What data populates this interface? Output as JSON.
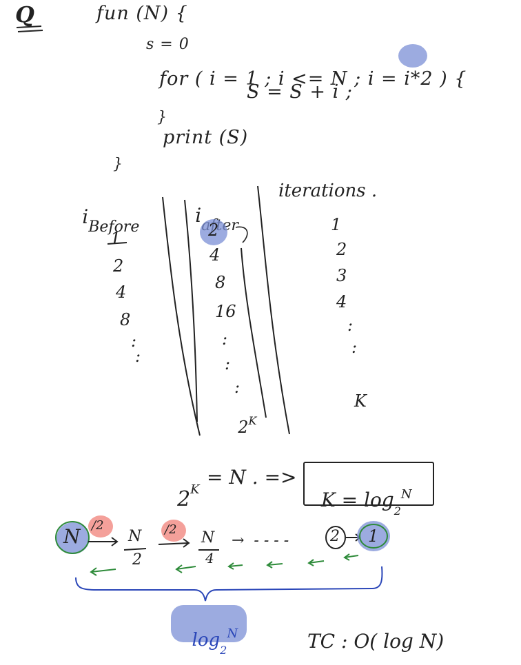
{
  "question_mark": "Q",
  "code": {
    "fn_header": "fun (N) {",
    "init": "s = 0",
    "loop_a": "for ( i = 1 ; i <= N ; i = ",
    "loop_op": "i*2",
    "loop_b": " ) {",
    "body": "S = S + i ;",
    "close_inner": "}",
    "print": "print (S)",
    "close_outer": "}"
  },
  "table": {
    "headers": [
      "i",
      "Before",
      "i",
      "after",
      "iterations ."
    ],
    "i_before": [
      "1",
      "2",
      "4",
      "8"
    ],
    "i_after": [
      "2",
      "4",
      "8",
      "16"
    ],
    "iterations": [
      "1",
      "2",
      "3",
      "4"
    ],
    "last_after_base": "2",
    "last_after_exp": "K",
    "last_iter": "K",
    "dots": ":"
  },
  "equation": {
    "lhs_base": "2",
    "lhs_exp": "K",
    "mid": "= N . =>",
    "boxed_k": "K = log",
    "boxed_base": "2",
    "boxed_n": "N"
  },
  "chain": {
    "start": "N",
    "step_label": "/2",
    "n_over_2_num": "N",
    "n_over_2_den": "2",
    "n_over_4_num": "N",
    "n_over_4_den": "4",
    "ellipsis": "→  - - - -",
    "two": "2",
    "one": "1"
  },
  "brace_label": {
    "log": "log",
    "base": "2",
    "n": "N"
  },
  "complexity": "TC : O( log N)",
  "colors": {
    "highlight_blue": "#7b8fd6",
    "highlight_red": "#f4a09a",
    "green_arrow": "#2e8b3a",
    "brace_blue": "#2a46b8"
  }
}
